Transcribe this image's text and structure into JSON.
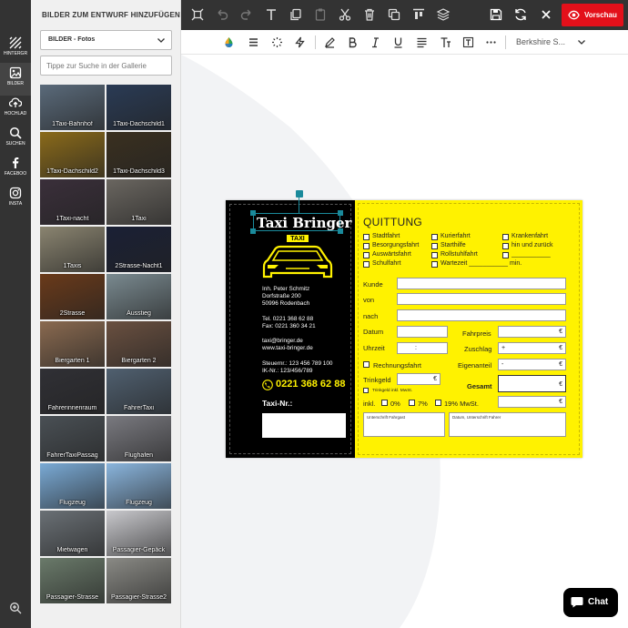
{
  "rail": {
    "items": [
      {
        "label": "HINTERGR",
        "icon": "background-icon"
      },
      {
        "label": "BILDER",
        "icon": "image-icon"
      },
      {
        "label": "HOCHLAD",
        "icon": "upload-icon"
      },
      {
        "label": "SUCHEN",
        "icon": "search-icon"
      },
      {
        "label": "FACEBOO",
        "icon": "facebook-icon"
      },
      {
        "label": "INSTA",
        "icon": "instagram-icon"
      }
    ],
    "zoom_icon": "zoom-icon"
  },
  "panel": {
    "title": "BILDER ZUM ENTWURF HINZUFÜGEN",
    "category": "BILDER - Fotos",
    "search_placeholder": "Tippe zur Suche in der Gallerie",
    "images": [
      {
        "label": "1Taxi-Bahnhof",
        "color": "#5a6a7a"
      },
      {
        "label": "1Taxi-Dachschild1",
        "color": "#2a3b55"
      },
      {
        "label": "1Taxi-Dachschild2",
        "color": "#8a6a1a"
      },
      {
        "label": "1Taxi-Dachschild3",
        "color": "#3a3020"
      },
      {
        "label": "1Taxi-nacht",
        "color": "#3a2f3a"
      },
      {
        "label": "1Taxi",
        "color": "#6a6660"
      },
      {
        "label": "1Taxis",
        "color": "#8a8470"
      },
      {
        "label": "2Strasse-Nacht1",
        "color": "#1a2035"
      },
      {
        "label": "2Strasse",
        "color": "#6a3a1a"
      },
      {
        "label": "Ausstieg",
        "color": "#7a8a90"
      },
      {
        "label": "Biergarten 1",
        "color": "#8a6a50"
      },
      {
        "label": "Biergarten 2",
        "color": "#6a5040"
      },
      {
        "label": "Fahrerinnenraum",
        "color": "#303035"
      },
      {
        "label": "FahrerTaxi",
        "color": "#506070"
      },
      {
        "label": "FahrerTaxiPassag",
        "color": "#4a5055"
      },
      {
        "label": "Flughafen",
        "color": "#7a7a80"
      },
      {
        "label": "Flugzeug",
        "color": "#7aaad5"
      },
      {
        "label": "Flugzeug",
        "color": "#8ab5dd"
      },
      {
        "label": "Mietwagen",
        "color": "#6a7075"
      },
      {
        "label": "Passagier-Gepäck",
        "color": "#c8c8cc"
      },
      {
        "label": "Passagier-Strasse",
        "color": "#6a7a6a"
      },
      {
        "label": "Passagier-Strasse2",
        "color": "#8a8a85"
      }
    ]
  },
  "toolbar": {
    "icons": [
      "group-icon",
      "undo-icon",
      "redo-icon",
      "text-icon",
      "copy-icon",
      "paste-icon",
      "cut-icon",
      "delete-icon",
      "duplicate-icon",
      "align-top-icon",
      "layers-icon",
      "save-icon",
      "refresh-icon",
      "close-icon"
    ],
    "preview_label": "Vorschau"
  },
  "format_bar": {
    "icons": [
      "color-wheel-icon",
      "line-spacing-icon",
      "effects-icon",
      "flash-icon",
      "pen-icon",
      "bold-icon",
      "italic-icon",
      "underline-icon",
      "align-icon",
      "text-size-icon",
      "text-frame-icon",
      "more-icon"
    ],
    "font_name": "Berkshire S..."
  },
  "card": {
    "brand": "Taxi Bringer",
    "sign_text": "TAXI",
    "contact": [
      "Inh. Peter Schmitz",
      "Dorfstraße 200",
      "50996 Rodenbach",
      "Tel. 0221 368 62 88",
      "Fax: 0221 360 34 21",
      "taxi@bringer.de",
      "www.taxi-bringer.de",
      "Steuernr.: 123 456 789 100",
      "IK-Nr.: 123/456/789"
    ],
    "phone": "0221 368 62 88",
    "taxinr_label": "Taxi-Nr.:",
    "quittung": "QUITTUNG",
    "checkboxes": [
      "Stadtfahrt",
      "Kurierfahrt",
      "Krankenfahrt",
      "Besorgungsfahrt",
      "Starthilfe",
      "hin und zurück",
      "Auswärtsfahrt",
      "Rollstuhlfahrt",
      "___________",
      "Schulfahrt",
      "Wartezeit ___________ min."
    ],
    "fields": {
      "kunde": "Kunde",
      "von": "von",
      "nach": "nach",
      "datum": "Datum",
      "uhrzeit": "Uhrzeit",
      "uhrzeit_sep": ":",
      "rechnungsfahrt": "Rechnungsfahrt",
      "trinkgeld": "Trinkgeld",
      "trinkgeld_inkl": "Trinkgeld inkl. MwSt.",
      "fahrpreis": "Fahrpreis",
      "zuschlag": "Zuschlag",
      "zuschlag_sign": "+",
      "eigenanteil": "Eigenanteil",
      "eigenanteil_sign": "-",
      "gesamt": "Gesamt",
      "currency": "€",
      "inkl": "inkl.",
      "vat0": "0%",
      "vat7": "7%",
      "vat19": "19% MwSt.",
      "sig_driver": "Unterschrift Fahrgast",
      "sig_date": "Datum, Unterschrift Fahrer"
    },
    "colors": {
      "yellow": "#fff200",
      "black": "#000000",
      "selection": "#1a8a9b"
    }
  },
  "chat": {
    "label": "Chat"
  }
}
